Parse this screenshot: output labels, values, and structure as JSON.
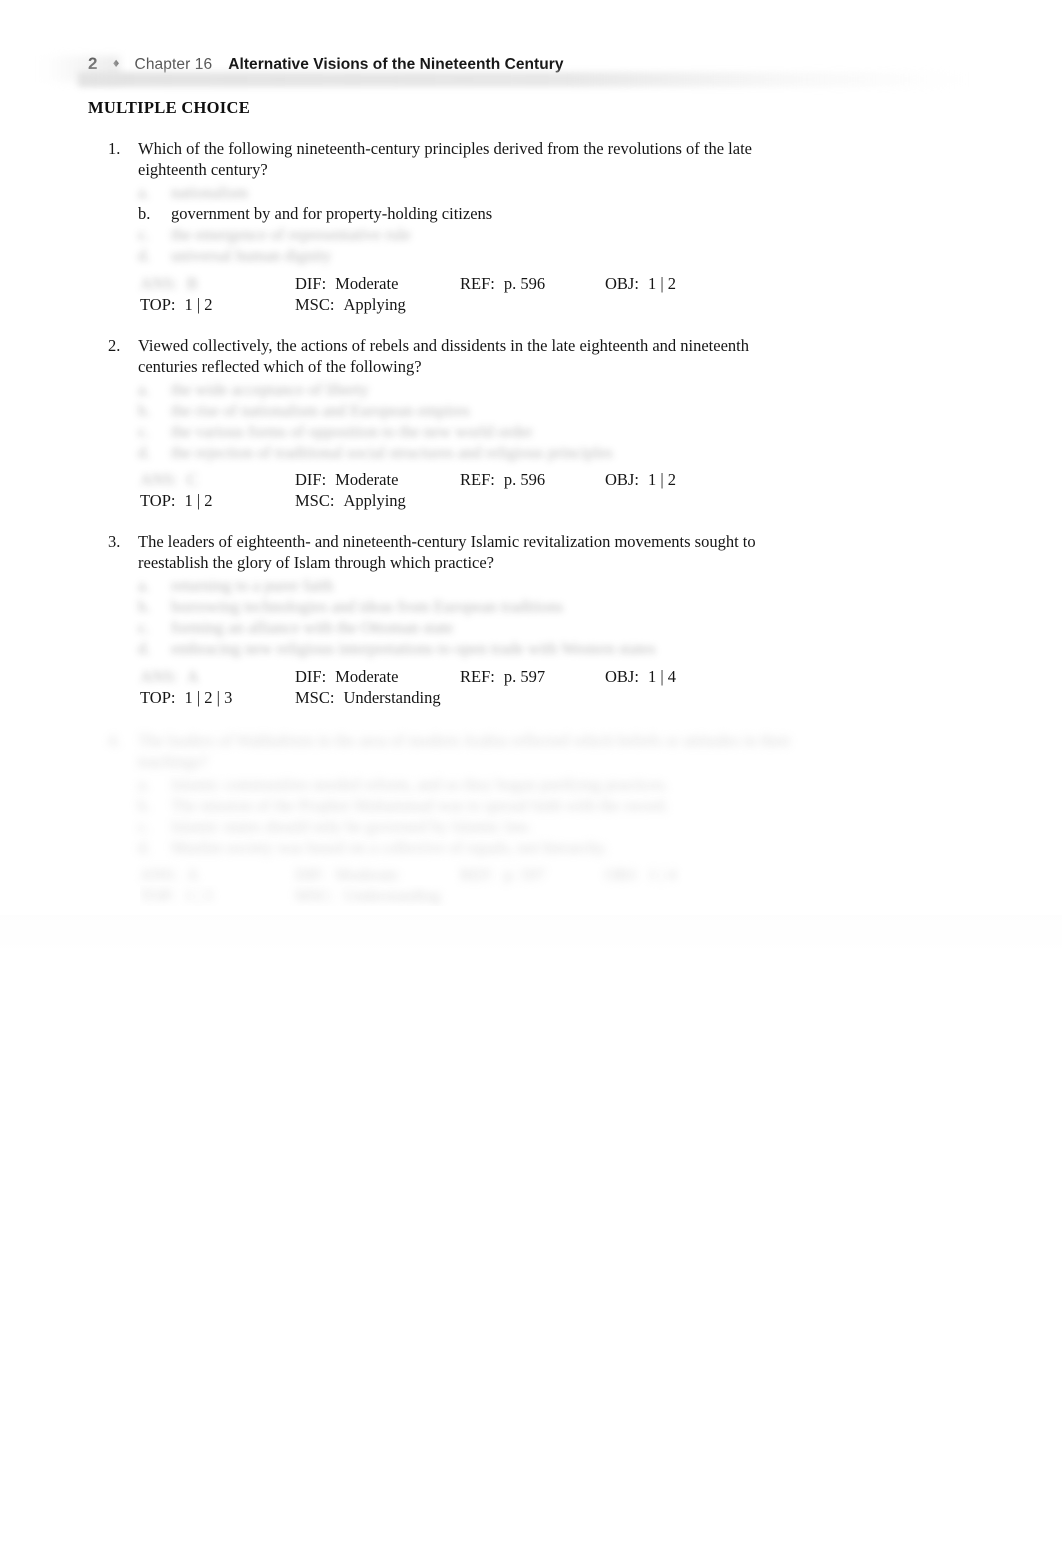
{
  "header": {
    "page_number": "2",
    "separator": "♦",
    "chapter": "Chapter 16",
    "title": "Alternative Visions of the Nineteenth Century"
  },
  "section_heading": "MULTIPLE CHOICE",
  "meta_labels": {
    "ans": "ANS:",
    "dif": "DIF:",
    "ref": "REF:",
    "obj": "OBJ:",
    "top": "TOP:",
    "msc": "MSC:"
  },
  "questions": [
    {
      "number": "1.",
      "stem": "Which of the following nineteenth-century principles derived from the revolutions of the late eighteenth century?",
      "options": [
        {
          "letter": "a.",
          "text": "nationalism",
          "legible": false
        },
        {
          "letter": "b.",
          "text": "government by and for property-holding citizens",
          "legible": true
        },
        {
          "letter": "c.",
          "text": "the emergence of representative rule",
          "legible": false
        },
        {
          "letter": "d.",
          "text": "universal human dignity",
          "legible": false
        }
      ],
      "meta": {
        "ans": "B",
        "ans_legible": false,
        "dif": "Moderate",
        "ref": "p.  596",
        "obj": "1 | 2",
        "top": "1 | 2",
        "msc": "Applying"
      }
    },
    {
      "number": "2.",
      "stem": "Viewed collectively, the actions of rebels and dissidents in the late eighteenth and nineteenth centuries reflected which of the following?",
      "options": [
        {
          "letter": "a.",
          "text": "the wide acceptance of liberty",
          "legible": false
        },
        {
          "letter": "b.",
          "text": "the rise of nationalism and European empires",
          "legible": false
        },
        {
          "letter": "c.",
          "text": "the various forms of opposition to the new world order",
          "legible": false
        },
        {
          "letter": "d.",
          "text": "the rejection of traditional social structures and religious principles",
          "legible": false
        }
      ],
      "meta": {
        "ans": "C",
        "ans_legible": false,
        "dif": "Moderate",
        "ref": "p.  596",
        "obj": "1 | 2",
        "top": "1 | 2",
        "msc": "Applying"
      }
    },
    {
      "number": "3.",
      "stem": "The leaders of eighteenth- and nineteenth-century Islamic revitalization movements sought to reestablish the glory of Islam through which practice?",
      "options": [
        {
          "letter": "a.",
          "text": "returning to a purer faith",
          "legible": false
        },
        {
          "letter": "b.",
          "text": "borrowing technologies and ideas from European traditions",
          "legible": false
        },
        {
          "letter": "c.",
          "text": "forming an alliance with the Ottoman state",
          "legible": false
        },
        {
          "letter": "d.",
          "text": "embracing new religious interpretations to open trade with Western states",
          "legible": false
        }
      ],
      "meta": {
        "ans": "A",
        "ans_legible": false,
        "dif": "Moderate",
        "ref": "p.  597",
        "obj": "1 | 4",
        "top": "1 | 2 | 3",
        "msc": "Understanding"
      }
    },
    {
      "number": "4.",
      "stem": "The leaders of Wahhabism in the area of modern Arabia reflected which beliefs or attitudes in their teachings?",
      "legible": false,
      "options": [
        {
          "letter": "a.",
          "text": "Islamic communities needed reform, and so they began purifying practices.",
          "legible": false
        },
        {
          "letter": "b.",
          "text": "The mission of the Prophet Muhammad was to spread faith with the sword.",
          "legible": false
        },
        {
          "letter": "c.",
          "text": "Islamic states should only be governed by Islamic law.",
          "legible": false
        },
        {
          "letter": "d.",
          "text": "Muslim society was based on a collective of equals, not hierarchy.",
          "legible": false
        }
      ],
      "meta": {
        "ans": "A",
        "ans_legible": false,
        "dif": "Moderate",
        "ref": "p.  597",
        "obj": "1 | 4",
        "top": "1 | 3",
        "msc": "Understanding",
        "legible": false
      }
    }
  ]
}
